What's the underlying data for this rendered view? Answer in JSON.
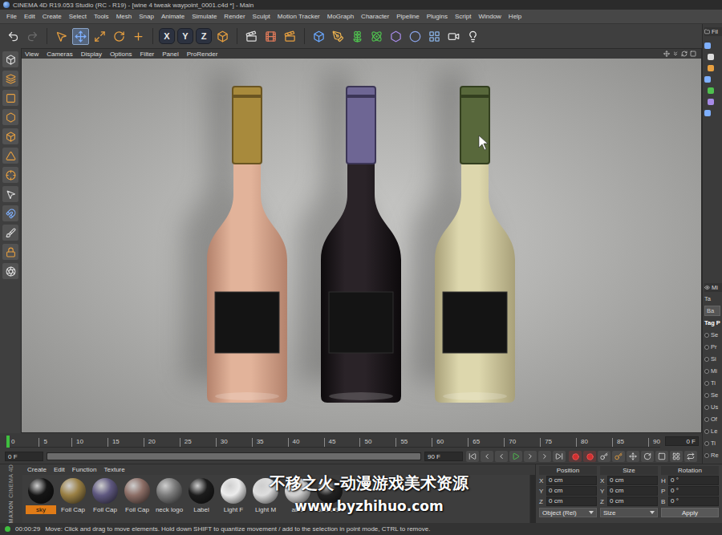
{
  "window": {
    "title": "CINEMA 4D R19.053 Studio (RC - R19) - [wine 4 tweak waypoint_0001.c4d *] - Main"
  },
  "menu": [
    "File",
    "Edit",
    "Create",
    "Select",
    "Tools",
    "Mesh",
    "Snap",
    "Animate",
    "Simulate",
    "Render",
    "Sculpt",
    "Motion Tracker",
    "MoGraph",
    "Character",
    "Pipeline",
    "Plugins",
    "Script",
    "Window",
    "Help"
  ],
  "toolbar": {
    "modes": [
      {
        "selected": false
      },
      {
        "selected": true
      },
      {
        "selected": false
      },
      {
        "selected": false
      },
      {
        "selected": false
      }
    ],
    "axes": [
      {
        "label": "X",
        "on": true
      },
      {
        "label": "Y",
        "on": true
      },
      {
        "label": "Z",
        "on": true
      }
    ]
  },
  "viewport": {
    "menu": [
      "View",
      "Cameras",
      "Display",
      "Options",
      "Filter",
      "Panel",
      "ProRender"
    ]
  },
  "right_panel": {
    "header": "Fil",
    "attributes_header": "Mi",
    "items": [
      {
        "label": "Ta",
        "kind": "text"
      },
      {
        "label": "Ba",
        "kind": "button"
      },
      {
        "label": "Tag P",
        "kind": "heading"
      },
      {
        "label": "Se",
        "kind": "radio"
      },
      {
        "label": "Pr",
        "kind": "radio"
      },
      {
        "label": "Si",
        "kind": "radio"
      },
      {
        "label": "Mi",
        "kind": "radio"
      },
      {
        "label": "Ti",
        "kind": "radio"
      },
      {
        "label": "Se",
        "kind": "radio"
      },
      {
        "label": "Us",
        "kind": "radio"
      },
      {
        "label": "Of",
        "kind": "radio"
      },
      {
        "label": "Le",
        "kind": "radio"
      },
      {
        "label": "Ti",
        "kind": "radio"
      },
      {
        "label": "Re",
        "kind": "radio"
      }
    ]
  },
  "timeline": {
    "ticks": [
      "0",
      "5",
      "10",
      "15",
      "20",
      "25",
      "30",
      "35",
      "40",
      "45",
      "50",
      "55",
      "60",
      "65",
      "70",
      "75",
      "80",
      "85",
      "90"
    ],
    "playhead_level": 0,
    "current": "0 F"
  },
  "transport": {
    "start": "0 F",
    "end": "90 F",
    "range_level": 1
  },
  "materials": {
    "menu": [
      "Create",
      "Edit",
      "Function",
      "Texture"
    ],
    "items": [
      {
        "name": "sky",
        "selected": true,
        "color": "#151515"
      },
      {
        "name": "Foil Cap",
        "selected": false,
        "color": "#9a8044"
      },
      {
        "name": "Foil Cap",
        "selected": false,
        "color": "#5f5880"
      },
      {
        "name": "Foil Cap",
        "selected": false,
        "color": "#8c6e66"
      },
      {
        "name": "neck logo",
        "selected": false,
        "color": "#7a7a7a"
      },
      {
        "name": "Label",
        "selected": false,
        "color": "#1c1c1c"
      },
      {
        "name": "Light F",
        "selected": false,
        "color": "#ececec"
      },
      {
        "name": "Light M",
        "selected": false,
        "color": "#dedede"
      },
      {
        "name": "able",
        "selected": false,
        "color": "#cfcfcf"
      },
      {
        "name": "Glass Blk",
        "selected": false,
        "color": "#222222"
      }
    ]
  },
  "coordinates": {
    "columns": [
      {
        "title": "Position",
        "rows": [
          {
            "axis": "X",
            "value": "0 cm"
          },
          {
            "axis": "Y",
            "value": "0 cm"
          },
          {
            "axis": "Z",
            "value": "0 cm"
          }
        ]
      },
      {
        "title": "Size",
        "rows": [
          {
            "axis": "X",
            "value": "0 cm"
          },
          {
            "axis": "Y",
            "value": "0 cm"
          },
          {
            "axis": "Z",
            "value": "0 cm"
          }
        ]
      },
      {
        "title": "Rotation",
        "rows": [
          {
            "axis": "H",
            "value": "0 °"
          },
          {
            "axis": "P",
            "value": "0 °"
          },
          {
            "axis": "B",
            "value": "0 °"
          }
        ]
      }
    ],
    "mode": "Object (Rel)",
    "size_mode": "Size",
    "apply": "Apply"
  },
  "brand": {
    "company": "MAXON",
    "product": "CINEMA 4D"
  },
  "status": {
    "time": "00:00:29",
    "message": "Move: Click and drag to move elements. Hold down SHIFT to quantize movement / add to the selection in point mode, CTRL to remove."
  },
  "watermark": {
    "lines": [
      "不移之火-动漫游戏美术资源",
      "www.byzhihuo.com"
    ]
  }
}
